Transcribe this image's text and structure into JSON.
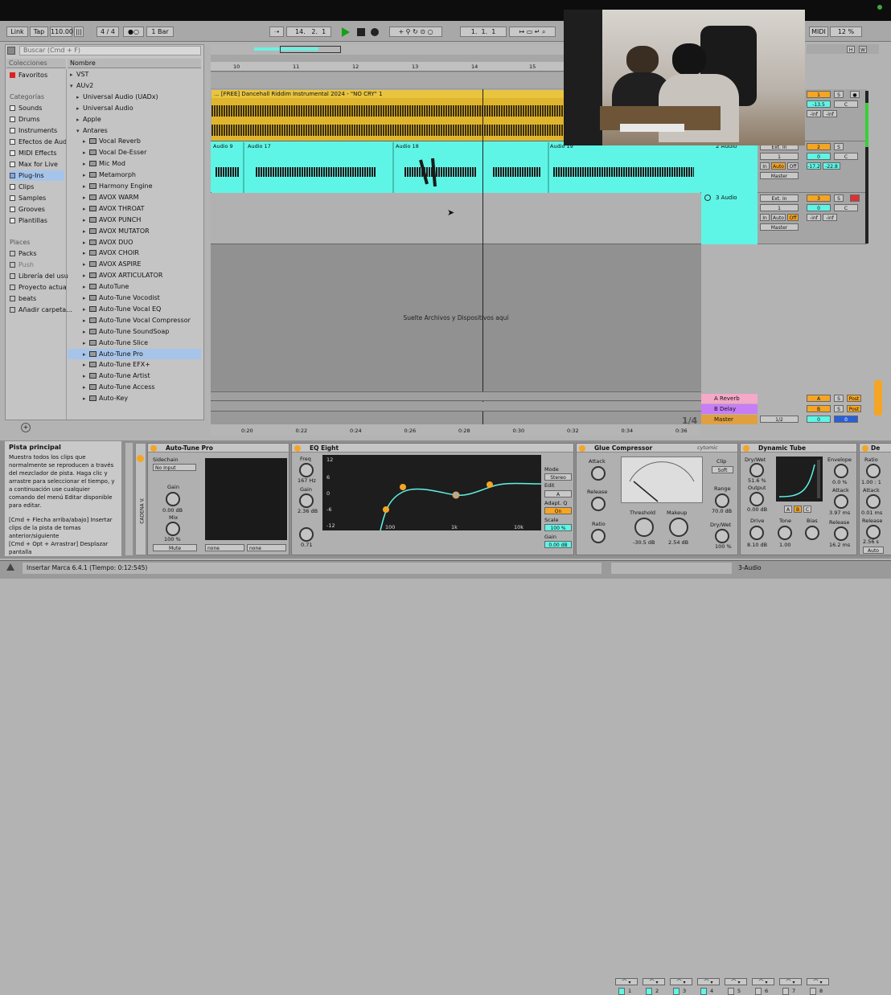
{
  "colors": {
    "audio_clip": "#e0b52e",
    "teal": "#5ef5e6",
    "accent_orange": "#f5a524",
    "return_a": "#f5a8c8",
    "return_b": "#c77df5",
    "master": "#e0a040"
  },
  "transport": {
    "link": "Link",
    "tap": "Tap",
    "bpm": "110.00",
    "sig": "4 / 4",
    "quant": "1 Bar",
    "pos_bar": "14",
    "pos_beat": "2",
    "pos_sub": "1",
    "loop_start": [
      "1",
      "1",
      "1"
    ],
    "midi": "MIDI",
    "cpu": "12 %"
  },
  "browser": {
    "search_placeholder": "Buscar (Cmd + F)",
    "col_left": "Colecciones",
    "col_right": "Nombre",
    "favorites": "Favoritos",
    "categories_title": "Categorías",
    "categories": [
      "Sounds",
      "Drums",
      "Instruments",
      "Efectos de Aud",
      "MIDI Effects",
      "Max for Live",
      "Plug-Ins",
      "Clips",
      "Samples",
      "Grooves",
      "Plantillas"
    ],
    "places_title": "Places",
    "places": [
      "Packs",
      "Push",
      "Librería del usu",
      "Proyecto actua",
      "beats",
      "Añadir carpeta..."
    ],
    "tree": [
      {
        "label": "VST",
        "indent": 0,
        "arrow": "▸",
        "plug": false
      },
      {
        "label": "AUv2",
        "indent": 0,
        "arrow": "▾",
        "plug": false
      },
      {
        "label": "Universal Audio (UADx)",
        "indent": 1,
        "arrow": "▸",
        "plug": false
      },
      {
        "label": "Universal Audio",
        "indent": 1,
        "arrow": "▸",
        "plug": false
      },
      {
        "label": "Apple",
        "indent": 1,
        "arrow": "▸",
        "plug": false
      },
      {
        "label": "Antares",
        "indent": 1,
        "arrow": "▾",
        "plug": false
      },
      {
        "label": "Vocal Reverb",
        "indent": 2,
        "arrow": "▸",
        "plug": true
      },
      {
        "label": "Vocal De-Esser",
        "indent": 2,
        "arrow": "▸",
        "plug": true
      },
      {
        "label": "Mic Mod",
        "indent": 2,
        "arrow": "▸",
        "plug": true
      },
      {
        "label": "Metamorph",
        "indent": 2,
        "arrow": "▸",
        "plug": true
      },
      {
        "label": "Harmony Engine",
        "indent": 2,
        "arrow": "▸",
        "plug": true
      },
      {
        "label": "AVOX WARM",
        "indent": 2,
        "arrow": "▸",
        "plug": true
      },
      {
        "label": "AVOX THROAT",
        "indent": 2,
        "arrow": "▸",
        "plug": true
      },
      {
        "label": "AVOX PUNCH",
        "indent": 2,
        "arrow": "▸",
        "plug": true
      },
      {
        "label": "AVOX MUTATOR",
        "indent": 2,
        "arrow": "▸",
        "plug": true
      },
      {
        "label": "AVOX DUO",
        "indent": 2,
        "arrow": "▸",
        "plug": true
      },
      {
        "label": "AVOX CHOIR",
        "indent": 2,
        "arrow": "▸",
        "plug": true
      },
      {
        "label": "AVOX ASPIRE",
        "indent": 2,
        "arrow": "▸",
        "plug": true
      },
      {
        "label": "AVOX ARTICULATOR",
        "indent": 2,
        "arrow": "▸",
        "plug": true
      },
      {
        "label": "AutoTune",
        "indent": 2,
        "arrow": "▸",
        "plug": true
      },
      {
        "label": "Auto-Tune Vocodist",
        "indent": 2,
        "arrow": "▸",
        "plug": true
      },
      {
        "label": "Auto-Tune Vocal EQ",
        "indent": 2,
        "arrow": "▸",
        "plug": true
      },
      {
        "label": "Auto-Tune Vocal Compressor",
        "indent": 2,
        "arrow": "▸",
        "plug": true
      },
      {
        "label": "Auto-Tune SoundSoap",
        "indent": 2,
        "arrow": "▸",
        "plug": true
      },
      {
        "label": "Auto-Tune Slice",
        "indent": 2,
        "arrow": "▸",
        "plug": true
      },
      {
        "label": "Auto-Tune Pro",
        "indent": 2,
        "arrow": "▸",
        "plug": true
      },
      {
        "label": "Auto-Tune EFX+",
        "indent": 2,
        "arrow": "▸",
        "plug": true
      },
      {
        "label": "Auto-Tune Artist",
        "indent": 2,
        "arrow": "▸",
        "plug": true
      },
      {
        "label": "Auto-Tune Access",
        "indent": 2,
        "arrow": "▸",
        "plug": true
      },
      {
        "label": "Auto-Key",
        "indent": 2,
        "arrow": "▸",
        "plug": true
      }
    ]
  },
  "ruler": {
    "bars": [
      "10",
      "11",
      "12",
      "13",
      "14",
      "15"
    ],
    "times": [
      "0:20",
      "0:22",
      "0:24",
      "0:26",
      "0:28",
      "0:30",
      "0:32",
      "0:34",
      "0:36"
    ]
  },
  "tracks": {
    "track1_clip": "... [FREE] Dancehall Riddim Instrumental 2024 - \"NO CRY\" 1",
    "track2_clips": [
      "Audio 9",
      "Audio 17",
      "Audio 18",
      "Audio 19"
    ],
    "track2_name": "2 Audio",
    "track3_name": "3 Audio",
    "drop_text": "Suelte Archivos y Dispositivos aquí",
    "returns": [
      "A Reverb",
      "B Delay"
    ],
    "master": "Master",
    "page": "1/4"
  },
  "mixer": {
    "t1": {
      "num": "1",
      "vol": "-13.5",
      "pan": "C",
      "a": "-inf",
      "b": "-inf"
    },
    "t2": {
      "input": "Ext. In",
      "ch": "1",
      "num": "2",
      "vol": "0",
      "pan": "C",
      "peak1": "-17.2",
      "peak2": "-22.8",
      "auto": "Auto",
      "off": "Off",
      "out": "Master",
      "in": "In"
    },
    "t3": {
      "input": "Ext. In",
      "ch": "1",
      "num": "3",
      "vol": "0",
      "pan": "C",
      "a": "-inf",
      "b": "-inf",
      "auto": "Auto",
      "off": "Off",
      "out": "Master",
      "in": "In"
    },
    "retA": "A",
    "retB": "B",
    "post": "Post",
    "s": "S",
    "master_vol": "0",
    "master_pan": "0",
    "master_sel": "1/2"
  },
  "info": {
    "title": "Pista principal",
    "body": "Muestra todos los clips que normalmente se reproducen a través del mezclador de pista. Haga clic y arrastre para seleccionar el tiempo, y a continuación use cualquier comando del menú Editar disponible para editar.",
    "hint1": "[Cmd + Flecha arriba/abajo] Insertar clips de la pista de tomas anterior/siguiente",
    "hint2": "[Cmd + Opt + Arrastrar] Desplazar pantalla"
  },
  "devices": {
    "chain_label": "CADENA V.",
    "autotune": {
      "title": "Auto-Tune Pro",
      "sidechain": "Sidechain",
      "input": "No Input",
      "gain": "Gain",
      "gain_val": "0.00 dB",
      "mix": "Mix",
      "mix_val": "100 %",
      "mute": "Mute",
      "none1": "none",
      "none2": "none"
    },
    "eq": {
      "title": "EQ Eight",
      "freq": "Freq",
      "freq_val": "167 Hz",
      "gain": "Gain",
      "gain_val": "2.36 dB",
      "q_val": "0.71",
      "mode": "Mode",
      "stereo": "Stereo",
      "edit": "Edit",
      "a": "A",
      "adapt": "Adapt. Q",
      "on": "On",
      "scale": "Scale",
      "scale_val": "100 %",
      "out_gain": "Gain",
      "out_gain_val": "0.00 dB",
      "y_labels": [
        "12",
        "6",
        "0",
        "-6",
        "-12"
      ],
      "x_labels": [
        "100",
        "1k",
        "10k"
      ],
      "bands": [
        "1",
        "2",
        "3",
        "4",
        "5",
        "6",
        "7",
        "8"
      ]
    },
    "glue": {
      "title": "Glue Compressor",
      "brand": "cytomic",
      "attack": "Attack",
      "release": "Release",
      "ratio": "Ratio",
      "threshold": "Threshold",
      "threshold_val": "-30.5 dB",
      "makeup": "Makeup",
      "makeup_val": "2.54 dB",
      "clip": "Clip",
      "soft": "Soft",
      "range": "Range",
      "range_val": "70.0 dB",
      "drywet": "Dry/Wet",
      "drywet_val": "100 %"
    },
    "tube": {
      "title": "Dynamic Tube",
      "drywet": "Dry/Wet",
      "drywet_val": "51.6 %",
      "output": "Output",
      "output_val": "0.00 dB",
      "drive": "Drive",
      "drive_val": "8.10 dB",
      "tone": "Tone",
      "tone_val": "1.00",
      "bias": "Bias",
      "envelope": "Envelope",
      "env_val": "0.0 %",
      "attack": "Attack",
      "attack_val": "3.97 ms",
      "release": "Release",
      "release_val": "16.2 ms",
      "abc": [
        "A",
        "B",
        "C"
      ]
    },
    "last": {
      "ratio": "Ratio",
      "ratio_val": "1.00 : 1",
      "attack": "Attack",
      "attack_val": "0.01 ms",
      "release": "Release",
      "release_val": "2.56 s",
      "auto": "Auto"
    }
  },
  "status": {
    "text": "Insertar Marca 6.4.1 (Tiempo: 0:12:545)",
    "track": "3-Audio"
  }
}
